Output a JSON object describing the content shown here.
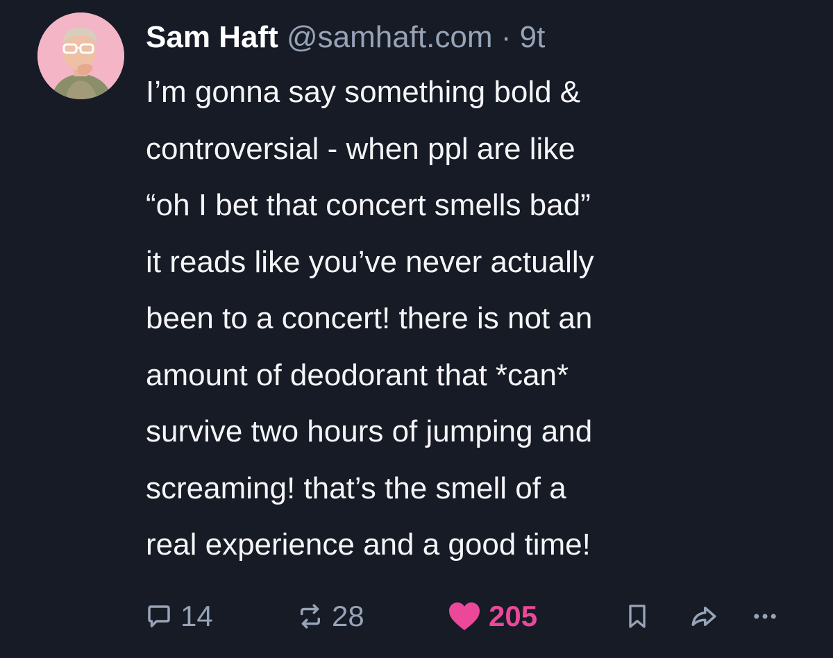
{
  "post": {
    "author_name": "Sam Haft",
    "handle": "@samhaft.com",
    "separator": "·",
    "time": "9t",
    "text": "I’m gonna say something bold &\ncontroversial - when ppl are like\n“oh I bet that concert smells bad”\nit reads like you’ve never actually\nbeen to a concert! there is not an\namount of deodorant that *can*\nsurvive two hours of jumping and\nscreaming! that’s the smell of a\nreal experience and a good time!"
  },
  "actions": {
    "reply_count": "14",
    "repost_count": "28",
    "like_count": "205"
  },
  "colors": {
    "background": "#161b26",
    "muted": "#97a3b6",
    "like": "#ec4899",
    "avatar_background": "#f4b6c6"
  },
  "icons": [
    "reply-icon",
    "repost-icon",
    "heart-icon",
    "bookmark-icon",
    "share-icon",
    "more-icon"
  ]
}
